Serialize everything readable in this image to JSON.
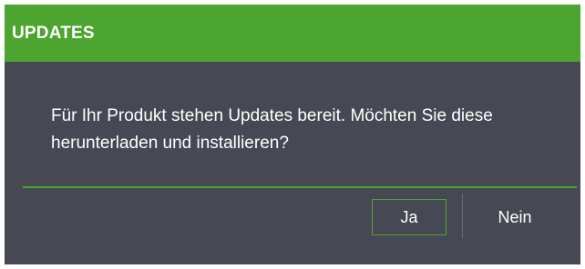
{
  "dialog": {
    "title": "UPDATES",
    "message": "Für Ihr Produkt stehen Updates bereit. Möchten Sie diese herunterladen und installieren?",
    "buttons": {
      "yes_label": "Ja",
      "no_label": "Nein"
    }
  },
  "colors": {
    "accent": "#4ca52f",
    "background": "#464953",
    "text": "#ffffff"
  }
}
